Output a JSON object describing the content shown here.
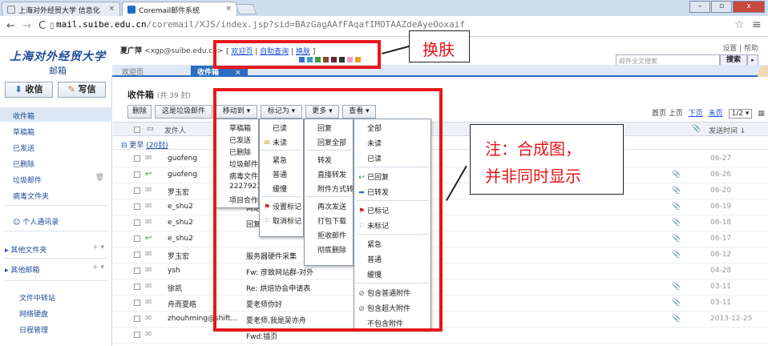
{
  "browser": {
    "tabs": [
      {
        "title": "上海对外经贸大学 信息化",
        "active": false
      },
      {
        "title": "Coremail邮件系统",
        "active": true
      }
    ],
    "url_domain": "mail.suibe.edu.cn",
    "url_path": "/coremail/XJS/index.jsp?sid=BAzGagAAfFAqafIMOTAAZdeAyeOoxaif",
    "window_buttons": [
      "–",
      "▫",
      "x"
    ]
  },
  "header": {
    "logo_text": "上海对外经贸大学",
    "logo_sub": "邮箱",
    "user_name": "夏广萍",
    "user_email": "<xgp@suibe.edu.cn>",
    "links": [
      "欢迎页",
      "自助查询",
      "换肤"
    ],
    "skin_colors": [
      "#3b6fc6",
      "#3c9bd1",
      "#3a9b3a",
      "#8a4a2a",
      "#6b2530",
      "#333333",
      "#f0a0c0",
      "#e8a030"
    ],
    "help_links": "设置 | 帮助",
    "search_placeholder": "邮件全文搜索",
    "search_button": "搜索",
    "search_arrow": "▸",
    "tabs": [
      {
        "label": "欢迎页"
      },
      {
        "label": "收件箱",
        "close": "×"
      }
    ]
  },
  "leftnav": {
    "receive_label": "收信",
    "write_label": "写信",
    "items": [
      {
        "label": "收件箱",
        "selected": true
      },
      {
        "label": "草稿箱"
      },
      {
        "label": "已发送"
      },
      {
        "label": "已删除"
      },
      {
        "label": "垃圾邮件",
        "side": "🗑"
      },
      {
        "label": "病毒文件夹"
      }
    ],
    "contacts": "个人通讯录",
    "other_folders": "其他文件夹",
    "other_mailbox": "其他邮箱",
    "plus": "+ ▾",
    "tools": [
      "文件中转站",
      "网络硬盘",
      "日程管理"
    ]
  },
  "main": {
    "folder_title": "收件箱",
    "folder_count": "(共 39 封)",
    "toolbar": [
      "删除",
      "这是垃圾邮件",
      "移动到 ▾",
      "标记为 ▾",
      "更多 ▾",
      "查看 ▾"
    ],
    "pager": {
      "first": "首页",
      "prev": "上页",
      "next": "下页",
      "last": "末页",
      "page": "1/2 ▾",
      "grid": "▦"
    },
    "columns": {
      "sender": "发件人",
      "attach": "📎",
      "date": "发送时间 ↓"
    },
    "group_label": "更早",
    "group_count": "(20封)",
    "rows": [
      {
        "sender": "guofeng",
        "subject": "",
        "attach": false,
        "date": "06-27",
        "icon": "✉"
      },
      {
        "sender": "guofeng",
        "subject": "",
        "attach": true,
        "date": "06-26",
        "icon": "↩"
      },
      {
        "sender": "罗玉宏",
        "subject": "",
        "attach": true,
        "date": "06-20",
        "icon": "✉"
      },
      {
        "sender": "e_shu2",
        "subject": "网站",
        "attach": true,
        "date": "06-19",
        "icon": "✉"
      },
      {
        "sender": "e_shu2",
        "subject": "回复",
        "attach": true,
        "date": "06-18",
        "icon": "✉"
      },
      {
        "sender": "e_shu2",
        "subject": "",
        "attach": true,
        "date": "06-17",
        "icon": "↩"
      },
      {
        "sender": "罗玉宏",
        "subject": "服务器硬件采集",
        "attach": true,
        "date": "06-12",
        "icon": "✉"
      },
      {
        "sender": "ysh",
        "subject": "Fw: 彦致网站群-对外",
        "attach": false,
        "date": "04-28",
        "icon": "✉"
      },
      {
        "sender": "徐凯",
        "subject": "Re: 烘焙协会申请表",
        "attach": true,
        "date": "03-11",
        "icon": "✉"
      },
      {
        "sender": "舟而夏皓",
        "subject": "夏老师你好",
        "attach": true,
        "date": "03-11",
        "icon": "✉"
      },
      {
        "sender": "zhouhming@shift...",
        "subject": "夏老师,我是吴亦舟",
        "attach": true,
        "date": "2013-12-25",
        "icon": "✉"
      },
      {
        "sender": "",
        "subject": "Fwd:插页",
        "attach": false,
        "date": "",
        "icon": "✉"
      }
    ],
    "menus": {
      "move_to": [
        "草稿箱",
        "已发送",
        "已删除",
        "垃圾邮件",
        "病毒文件夹",
        "22279211@c...",
        "项目合作"
      ],
      "mark_as": [
        "已读",
        "未读",
        "紧急",
        "普通",
        "缓慢",
        "设置标记",
        "取消标记"
      ],
      "more": [
        "回复",
        "回复全部",
        "转发",
        "直接转发",
        "附件方式转发",
        "再次发送",
        "打包下载",
        "拒收邮件",
        "彻底删除"
      ],
      "view": [
        "全部",
        "未读",
        "已读",
        "已回复",
        "已转发",
        "已标记",
        "未标记",
        "紧急",
        "普通",
        "缓慢",
        "包含普通附件",
        "包含超大附件",
        "不包含附件"
      ]
    }
  },
  "annotations": {
    "skin_label": "换肤",
    "note_line1": "注：合成图，",
    "note_line2": "并非同时显示"
  }
}
